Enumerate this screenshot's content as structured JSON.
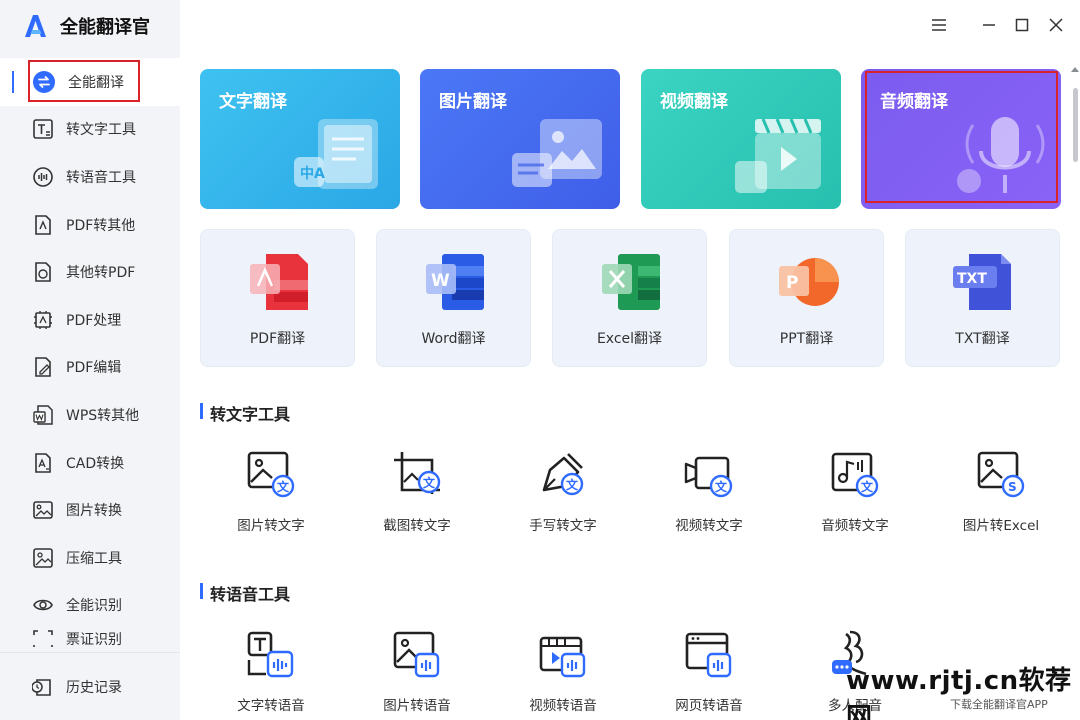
{
  "app": {
    "title": "全能翻译官"
  },
  "window_controls": {
    "menu": "menu-icon",
    "minimize": "minimize-icon",
    "maximize": "maximize-icon",
    "close": "close-icon"
  },
  "sidebar": {
    "items": [
      {
        "label": "全能翻译",
        "icon": "translate-swap-icon",
        "active": true
      },
      {
        "label": "转文字工具",
        "icon": "text-convert-icon"
      },
      {
        "label": "转语音工具",
        "icon": "voice-convert-icon"
      },
      {
        "label": "PDF转其他",
        "icon": "pdf-export-icon"
      },
      {
        "label": "其他转PDF",
        "icon": "pdf-import-icon"
      },
      {
        "label": "PDF处理",
        "icon": "pdf-process-icon"
      },
      {
        "label": "PDF编辑",
        "icon": "pdf-edit-icon"
      },
      {
        "label": "WPS转其他",
        "icon": "wps-convert-icon"
      },
      {
        "label": "CAD转换",
        "icon": "cad-convert-icon"
      },
      {
        "label": "图片转换",
        "icon": "image-convert-icon"
      },
      {
        "label": "压缩工具",
        "icon": "compress-icon"
      },
      {
        "label": "全能识别",
        "icon": "recognize-eye-icon"
      },
      {
        "label": "票证识别",
        "icon": "ticket-scan-icon"
      }
    ],
    "bottom": {
      "label": "历史记录",
      "icon": "history-icon"
    }
  },
  "translate_cards": [
    {
      "label": "文字翻译",
      "icon": "text-translate-illustration"
    },
    {
      "label": "图片翻译",
      "icon": "image-translate-illustration"
    },
    {
      "label": "视频翻译",
      "icon": "video-translate-illustration"
    },
    {
      "label": "音频翻译",
      "icon": "audio-translate-illustration"
    }
  ],
  "doc_cards": [
    {
      "label": "PDF翻译",
      "icon": "pdf-file-icon",
      "color": "#e8323c"
    },
    {
      "label": "Word翻译",
      "icon": "word-file-icon",
      "color": "#2b5ce6"
    },
    {
      "label": "Excel翻译",
      "icon": "excel-file-icon",
      "color": "#1f9a55"
    },
    {
      "label": "PPT翻译",
      "icon": "ppt-file-icon",
      "color": "#f2682b"
    },
    {
      "label": "TXT翻译",
      "icon": "txt-file-icon",
      "color": "#3f52d8"
    }
  ],
  "sections": {
    "text_tools": {
      "title": "转文字工具",
      "items": [
        {
          "label": "图片转文字",
          "icon": "image-to-text-icon"
        },
        {
          "label": "截图转文字",
          "icon": "screenshot-to-text-icon"
        },
        {
          "label": "手写转文字",
          "icon": "handwriting-to-text-icon"
        },
        {
          "label": "视频转文字",
          "icon": "video-to-text-icon"
        },
        {
          "label": "音频转文字",
          "icon": "audio-to-text-icon"
        },
        {
          "label": "图片转Excel",
          "icon": "image-to-excel-icon"
        }
      ]
    },
    "voice_tools": {
      "title": "转语音工具",
      "items": [
        {
          "label": "文字转语音",
          "icon": "text-to-speech-icon"
        },
        {
          "label": "图片转语音",
          "icon": "image-to-speech-icon"
        },
        {
          "label": "视频转语音",
          "icon": "video-to-speech-icon"
        },
        {
          "label": "网页转语音",
          "icon": "webpage-to-speech-icon"
        },
        {
          "label": "多人配音",
          "icon": "multi-voice-dubbing-icon"
        }
      ]
    }
  },
  "watermark": {
    "text": "www.rjtj.cn软荐网",
    "subtext": "下载全能翻译官APP"
  },
  "colors": {
    "accent": "#2f6bff",
    "highlight_box": "#d8232a",
    "sidebar_bg": "#f3f4f8"
  }
}
